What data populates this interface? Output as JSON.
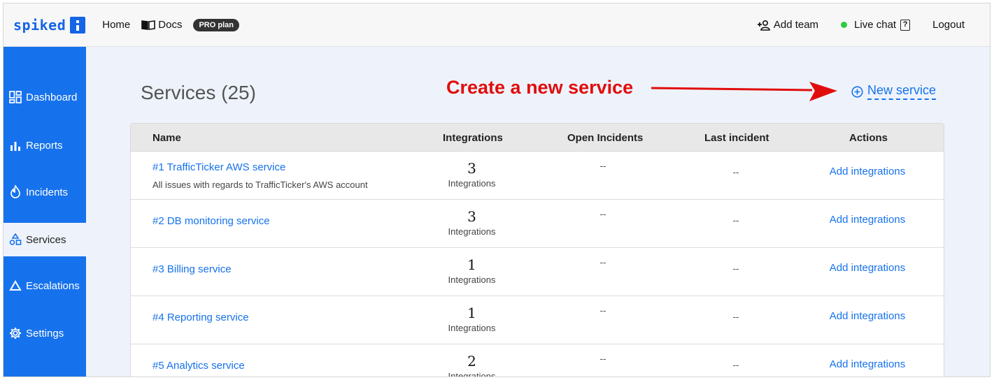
{
  "brand": {
    "logo_text": "spiked"
  },
  "topnav": {
    "home": "Home",
    "docs": "Docs",
    "plan_badge": "PRO plan",
    "add_team": "Add team",
    "live_chat": "Live chat",
    "live_chat_help": "?",
    "logout": "Logout"
  },
  "sidebar": {
    "items": [
      {
        "label": "Dashboard",
        "icon": "dashboard-icon"
      },
      {
        "label": "Reports",
        "icon": "bar-chart-icon"
      },
      {
        "label": "Incidents",
        "icon": "flame-icon"
      },
      {
        "label": "Services",
        "icon": "shapes-icon",
        "active": true
      },
      {
        "label": "Escalations",
        "icon": "triangle-icon"
      },
      {
        "label": "Settings",
        "icon": "gear-icon"
      }
    ]
  },
  "main": {
    "title": "Services (25)",
    "annotation": "Create a new service",
    "new_service_label": "New service"
  },
  "table": {
    "headers": [
      "Name",
      "Integrations",
      "Open Incidents",
      "Last incident",
      "Actions"
    ],
    "rows": [
      {
        "name": "#1 TrafficTicker AWS service",
        "description": "All issues with regards to TrafficTicker's AWS account",
        "integrations": "3",
        "integrations_label": "Integrations",
        "open_incidents": "--",
        "last_incident": "--",
        "action": "Add integrations"
      },
      {
        "name": "#2 DB monitoring service",
        "description": "",
        "integrations": "3",
        "integrations_label": "Integrations",
        "open_incidents": "--",
        "last_incident": "--",
        "action": "Add integrations"
      },
      {
        "name": "#3 Billing service",
        "description": "",
        "integrations": "1",
        "integrations_label": "Integrations",
        "open_incidents": "--",
        "last_incident": "--",
        "action": "Add integrations"
      },
      {
        "name": "#4 Reporting service",
        "description": "",
        "integrations": "1",
        "integrations_label": "Integrations",
        "open_incidents": "--",
        "last_incident": "--",
        "action": "Add integrations"
      },
      {
        "name": "#5 Analytics service",
        "description": "",
        "integrations": "2",
        "integrations_label": "Integrations",
        "open_incidents": "--",
        "last_incident": "--",
        "action": "Add integrations"
      }
    ]
  },
  "colors": {
    "brand_blue": "#1672ec",
    "annotation_red": "#e10d0d",
    "live_green": "#2ecc40"
  }
}
